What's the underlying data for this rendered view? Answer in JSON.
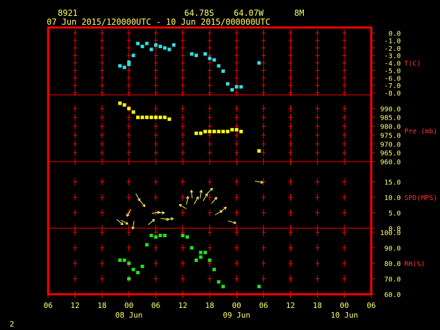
{
  "header": {
    "station": "8921",
    "lat": "64.78S",
    "lon": "64.07W",
    "height": "8M",
    "range": "07 Jun 2015/120000UTC - 10 Jun 2015/000000UTC"
  },
  "footer": {
    "page_number": "2"
  },
  "colors": {
    "frame": "#ff0000",
    "grid": "#ff0000",
    "temp": "#33dddd",
    "pres": "#ffff00",
    "wind": "#ffff66",
    "rh": "#22dd22",
    "axis_text": "#ffff66",
    "label_text": "#ff3333",
    "header_text": "#ffff66"
  },
  "chart_data": {
    "type": "scatter",
    "x_axis": {
      "unit": "hours since 07 Jun 2015 06:00 UTC",
      "range": [
        0,
        72
      ],
      "tick_labels": [
        "06",
        "12",
        "18",
        "00",
        "06",
        "12",
        "18",
        "00",
        "06",
        "12",
        "18",
        "00",
        "06"
      ],
      "day_labels": [
        {
          "x": 18,
          "text": "08 Jun"
        },
        {
          "x": 42,
          "text": "09 Jun"
        },
        {
          "x": 66,
          "text": "10 Jun"
        }
      ]
    },
    "panels": [
      {
        "id": "temp",
        "label": "T(C)",
        "marker": "square",
        "ylim": [
          -8,
          0
        ],
        "ticks": [
          "0.0",
          "-1.0",
          "-2.0",
          "-3.0",
          "-4.0",
          "-5.0",
          "-6.0",
          "-7.0",
          "-8.0"
        ],
        "points": [
          [
            16,
            -4.4
          ],
          [
            17,
            -4.6
          ],
          [
            18,
            -4.2
          ],
          [
            18,
            -3.9
          ],
          [
            19,
            -3.0
          ],
          [
            20,
            -1.4
          ],
          [
            21,
            -1.8
          ],
          [
            22,
            -1.4
          ],
          [
            23,
            -2.2
          ],
          [
            24,
            -1.6
          ],
          [
            25,
            -1.8
          ],
          [
            26,
            -2.0
          ],
          [
            27,
            -2.2
          ],
          [
            28,
            -1.6
          ],
          [
            32,
            -2.8
          ],
          [
            33,
            -3.0
          ],
          [
            35,
            -2.8
          ],
          [
            36,
            -3.4
          ],
          [
            37,
            -3.6
          ],
          [
            38,
            -4.4
          ],
          [
            39,
            -5.1
          ],
          [
            40,
            -6.8
          ],
          [
            41,
            -7.6
          ],
          [
            42,
            -7.2
          ],
          [
            43,
            -7.2
          ],
          [
            47,
            -4.0
          ]
        ]
      },
      {
        "id": "pres",
        "label": "Pre (mb)",
        "marker": "square",
        "ylim": [
          960,
          995
        ],
        "ticks": [
          "990.0",
          "985.0",
          "980.0",
          "975.0",
          "970.0",
          "965.0",
          "960.0"
        ],
        "points": [
          [
            16,
            993
          ],
          [
            17,
            992
          ],
          [
            18,
            990
          ],
          [
            19,
            988
          ],
          [
            20,
            985
          ],
          [
            21,
            985
          ],
          [
            22,
            985
          ],
          [
            23,
            985
          ],
          [
            24,
            985
          ],
          [
            25,
            985
          ],
          [
            26,
            985
          ],
          [
            27,
            984
          ],
          [
            33,
            976
          ],
          [
            34,
            976
          ],
          [
            35,
            977
          ],
          [
            36,
            977
          ],
          [
            37,
            977
          ],
          [
            38,
            977
          ],
          [
            39,
            977
          ],
          [
            40,
            977
          ],
          [
            41,
            978
          ],
          [
            42,
            978
          ],
          [
            43,
            977
          ],
          [
            47,
            966
          ]
        ]
      },
      {
        "id": "wind",
        "label": "SPD(MPS)",
        "marker": "arrow",
        "ylim": [
          0,
          20
        ],
        "ticks": [
          "15.0",
          "10.0",
          "5.0",
          "0.0"
        ],
        "points": [
          [
            16,
            2,
            -40
          ],
          [
            17,
            2,
            -30
          ],
          [
            18,
            5,
            -120
          ],
          [
            19,
            1,
            -100
          ],
          [
            20,
            10,
            -60
          ],
          [
            21,
            8,
            -50
          ],
          [
            23,
            2,
            40
          ],
          [
            24,
            5,
            10
          ],
          [
            25,
            5,
            0
          ],
          [
            26,
            3,
            -10
          ],
          [
            27,
            3,
            5
          ],
          [
            30,
            7,
            150
          ],
          [
            31,
            9,
            80
          ],
          [
            32,
            11,
            95
          ],
          [
            33,
            9,
            60
          ],
          [
            34,
            11,
            80
          ],
          [
            35,
            10,
            60
          ],
          [
            36,
            12,
            45
          ],
          [
            37,
            9,
            50
          ],
          [
            38,
            5,
            30
          ],
          [
            39,
            6,
            40
          ],
          [
            41,
            2,
            -15
          ],
          [
            47,
            15,
            -10
          ]
        ]
      },
      {
        "id": "rh",
        "label": "RH(%)",
        "marker": "square",
        "ylim": [
          60,
          100
        ],
        "ticks": [
          "100.0",
          "90.0",
          "80.0",
          "70.0",
          "60.0"
        ],
        "points": [
          [
            16,
            82
          ],
          [
            17,
            82
          ],
          [
            18,
            80
          ],
          [
            18,
            70
          ],
          [
            19,
            76
          ],
          [
            20,
            74
          ],
          [
            21,
            78
          ],
          [
            22,
            92
          ],
          [
            23,
            98
          ],
          [
            24,
            97
          ],
          [
            25,
            98
          ],
          [
            26,
            98
          ],
          [
            30,
            98
          ],
          [
            31,
            97
          ],
          [
            32,
            90
          ],
          [
            33,
            82
          ],
          [
            34,
            84
          ],
          [
            34,
            87
          ],
          [
            35,
            87
          ],
          [
            36,
            82
          ],
          [
            37,
            76
          ],
          [
            38,
            68
          ],
          [
            39,
            65
          ],
          [
            47,
            65
          ]
        ]
      }
    ]
  }
}
